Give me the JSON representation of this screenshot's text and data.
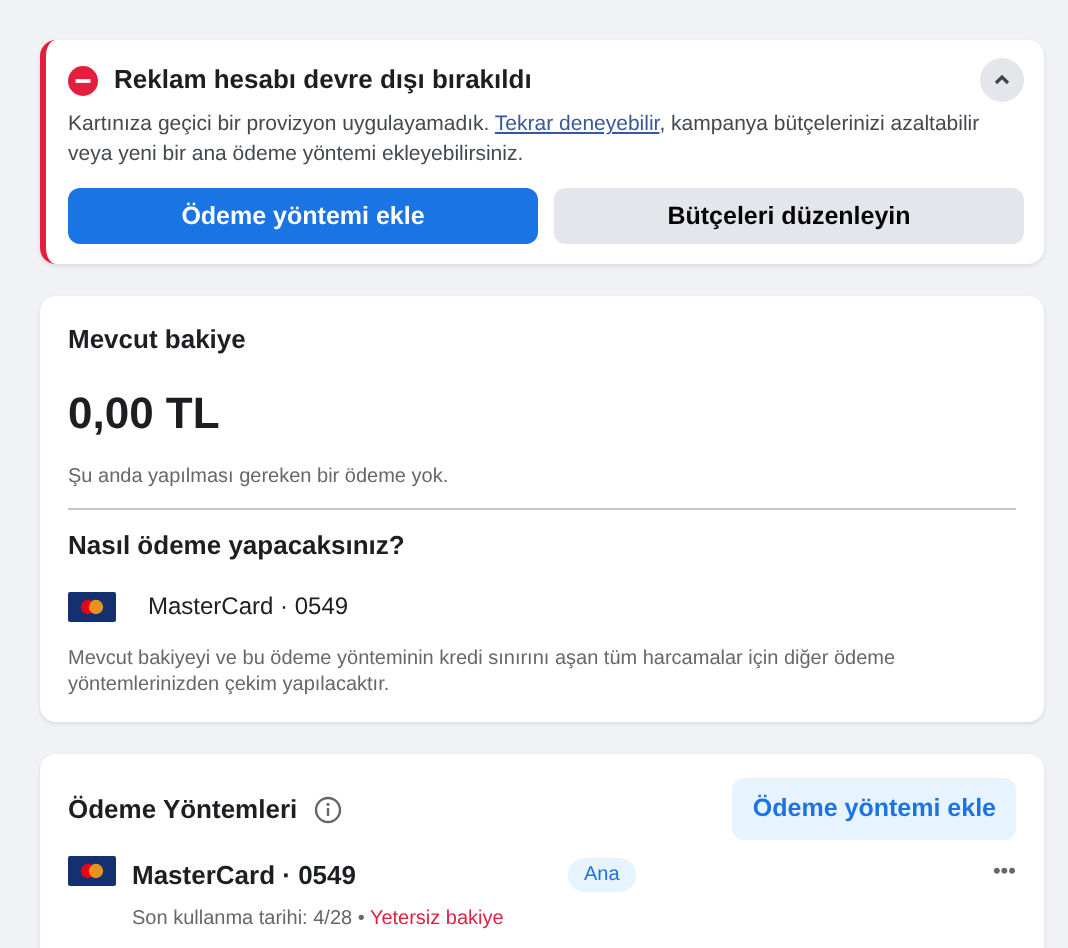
{
  "alert": {
    "title": "Reklam hesabı devre dışı bırakıldı",
    "expanded": true,
    "text_before": "Kartınıza geçici bir provizyon uygulayamadık. ",
    "link": "Tekrar deneyebilir",
    "text_after": ", kampanya bütçelerinizi azaltabilir veya yeni bir ana ödeme yöntemi ekleyebilirsiniz.",
    "buttons": [
      {
        "label": "Ödeme yöntemi ekle",
        "kind": "primary"
      },
      {
        "label": "Bütçeleri düzenleyin",
        "kind": "secondary"
      }
    ]
  },
  "balance": {
    "title": "Mevcut bakiye",
    "amount": "0,00 TL",
    "note": "Şu anda yapılması gereken bir ödeme yok.",
    "question": "Nasıl ödeme yapacaksınız?",
    "card": "MasterCard · 0549",
    "info": "Mevcut bakiyeyi ve bu ödeme yönteminin kredi sınırını aşan tüm harcamalar için diğer ödeme yöntemlerinizden çekim yapılacaktır."
  },
  "methods": {
    "title": "Ödeme Yöntemleri",
    "add_button": "Ödeme yöntemi ekle",
    "items": [
      {
        "name": "MasterCard · 0549",
        "badge": "Ana",
        "expiry": "Son kullanma tarihi: 4/28 • ",
        "warning": "Yetersiz bakiye",
        "menu": "•••"
      }
    ]
  }
}
